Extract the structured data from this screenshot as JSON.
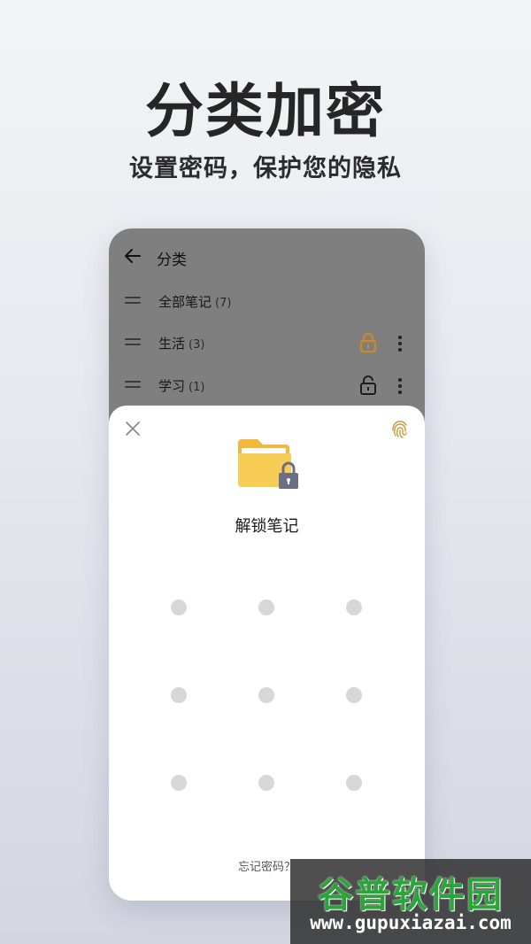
{
  "hero": {
    "title": "分类加密",
    "subtitle": "设置密码，保护您的隐私"
  },
  "list_screen": {
    "title": "分类",
    "categories": [
      {
        "name": "全部笔记",
        "count": "(7)",
        "lock": "none"
      },
      {
        "name": "生活",
        "count": "(3)",
        "lock": "locked-orange"
      },
      {
        "name": "学习",
        "count": "(1)",
        "lock": "unlocked-dark"
      }
    ],
    "icons": {
      "back": "arrow-left-icon",
      "handle": "drag-handle-icon",
      "more": "more-vertical-icon"
    }
  },
  "unlock_sheet": {
    "title": "解锁笔记",
    "forgot_label": "忘记密码？",
    "pattern_dots": 9,
    "icons": {
      "close": "close-icon",
      "fingerprint": "fingerprint-icon",
      "folder": "locked-folder-icon"
    }
  },
  "watermark": {
    "logo": "谷普软件园",
    "url": "www.gupuxiazai.com"
  },
  "colors": {
    "lock_accent": "#d18a1c",
    "folder_yellow": "#f8cd55",
    "fingerprint": "#c79a3b",
    "overlay": "#7f7f7f",
    "watermark_green": "#2aa53a"
  }
}
